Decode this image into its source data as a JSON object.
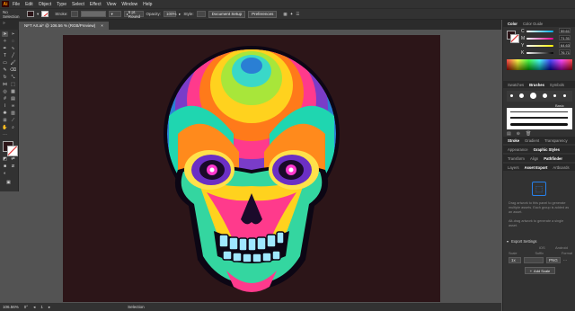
{
  "app": {
    "logo_text": "Ai"
  },
  "menu": [
    "File",
    "Edit",
    "Object",
    "Type",
    "Select",
    "Effect",
    "View",
    "Window",
    "Help"
  ],
  "control_bar": {
    "selection_label": "No Selection",
    "stroke_label": "Stroke:",
    "brush_label": "5 pt. Round",
    "opacity_label": "Opacity:",
    "opacity_value": "100%",
    "style_label": "Style:",
    "document_setup": "Document Setup",
    "preferences": "Preferences"
  },
  "document_tab": {
    "title": "NFT Art.ai* @ 106.56 % (RGB/Preview)",
    "close": "×"
  },
  "status_bar": {
    "zoom": "106.56%",
    "rotation": "0°",
    "page": "1",
    "tool": "Selection"
  },
  "color_panel": {
    "tabs": [
      "Color",
      "Color Guide"
    ],
    "channels": [
      {
        "label": "C",
        "value": "59.61"
      },
      {
        "label": "M",
        "value": "71.31"
      },
      {
        "label": "Y",
        "value": "64.63"
      },
      {
        "label": "K",
        "value": "76.71"
      }
    ]
  },
  "brush_panel": {
    "tabs": [
      "Swatches",
      "Brushes",
      "Symbols"
    ],
    "preset_label": "Basic"
  },
  "stroke_panel": {
    "tabs": [
      "Stroke",
      "Gradient",
      "Transparency"
    ]
  },
  "appearance_panel": {
    "tabs": [
      "Appearance",
      "Graphic Styles"
    ]
  },
  "transform_panel": {
    "tabs": [
      "Transform",
      "Align",
      "Pathfinder"
    ]
  },
  "export_panel": {
    "tabs": [
      "Layers",
      "Asset Export",
      "Artboards"
    ],
    "hint1": "Drag artwork to this panel to generate multiple assets. Each group is added as an asset.",
    "hint2": "Alt-drag artwork to generate a single asset.",
    "settings_label": "Export Settings",
    "scale_headers": [
      "Scale",
      "Suffix",
      "Format"
    ],
    "scale_value": "1x",
    "format_value": "PNG",
    "ios_label": "iOS",
    "android_label": "Android",
    "add_scale": "Add Scale"
  },
  "colors": {
    "ui_dark": "#323232",
    "canvas": "#535353",
    "artboard": "#2c1518",
    "accent": "#2680eb"
  }
}
